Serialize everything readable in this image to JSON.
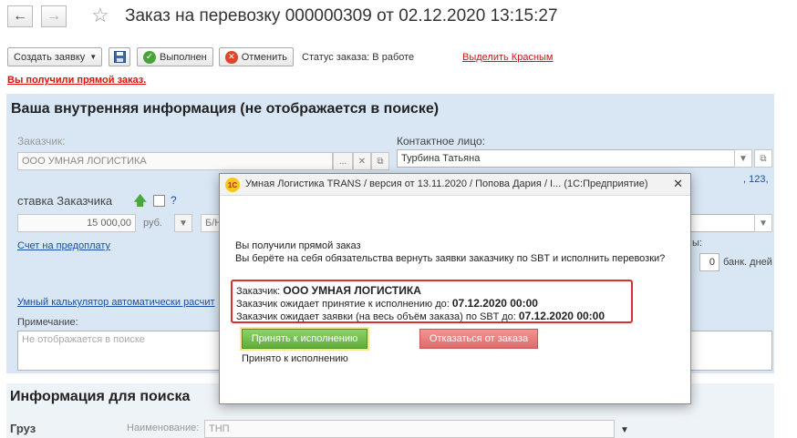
{
  "window": {
    "back_icon": "←",
    "forward_icon": "→",
    "star_icon": "☆",
    "title": "Заказ на перевозку 000000309 от 02.12.2020 13:15:27"
  },
  "toolbar": {
    "create_request": "Создать заявку",
    "save_icon": "floppy-icon",
    "done": "Выполнен",
    "cancel": "Отменить",
    "status": "Статус заказа: В работе",
    "highlight_red": "Выделить Красным"
  },
  "alert": "Вы получили прямой заказ.",
  "internal": {
    "heading": "Ваша внутренняя информация (не отображается в поиске)",
    "customer_label": "Заказчик:",
    "customer_value": "ООО УМНАЯ ЛОГИСТИКА",
    "contact_label": "Контактное лицо:",
    "contact_value": "Турбина Татьяна",
    "code_hint": ", 123,",
    "rate_label": "ставка Заказчика",
    "rate_help": "?",
    "rate_value": "15 000,00",
    "rate_currency": "руб.",
    "rate_vat": "Б/Н",
    "invoice_link": "Счет на предоплату",
    "days_label": "ы:",
    "days_value": "0",
    "days_unit": "банк. дней",
    "calculator_link": "Умный калькулятор автоматически расчит",
    "note_label": "Примечание:",
    "note_placeholder": "Не отображается в поиске"
  },
  "search_info": {
    "heading": "Информация для поиска",
    "cargo_label": "Груз",
    "name_label": "Наименование:",
    "name_value": "ТНП"
  },
  "modal": {
    "title": "Умная Логистика TRANS / версия от 13.11.2020 / Попова Дария / I...  (1С:Предприятие)",
    "logo": "1С",
    "close": "✕",
    "message_line1": "Вы получили прямой заказ",
    "message_line2": "Вы берёте на себя обязательства вернуть заявки заказчику по SBT и исполнить перевозки?",
    "customer_prefix": "Заказчик: ",
    "customer_name": "ООО УМНАЯ ЛОГИСТИКА",
    "accept_deadline_prefix": "Заказчик ожидает принятие к исполнению до: ",
    "accept_deadline": "07.12.2020 00:00",
    "requests_deadline_prefix": "Заказчик ожидает заявки (на весь объём заказа) по SBT до: ",
    "requests_deadline": "07.12.2020 00:00",
    "accept_button": "Принять к исполнению",
    "refuse_button": "Отказаться от заказа",
    "accepted_text": "Принято к исполнению"
  }
}
